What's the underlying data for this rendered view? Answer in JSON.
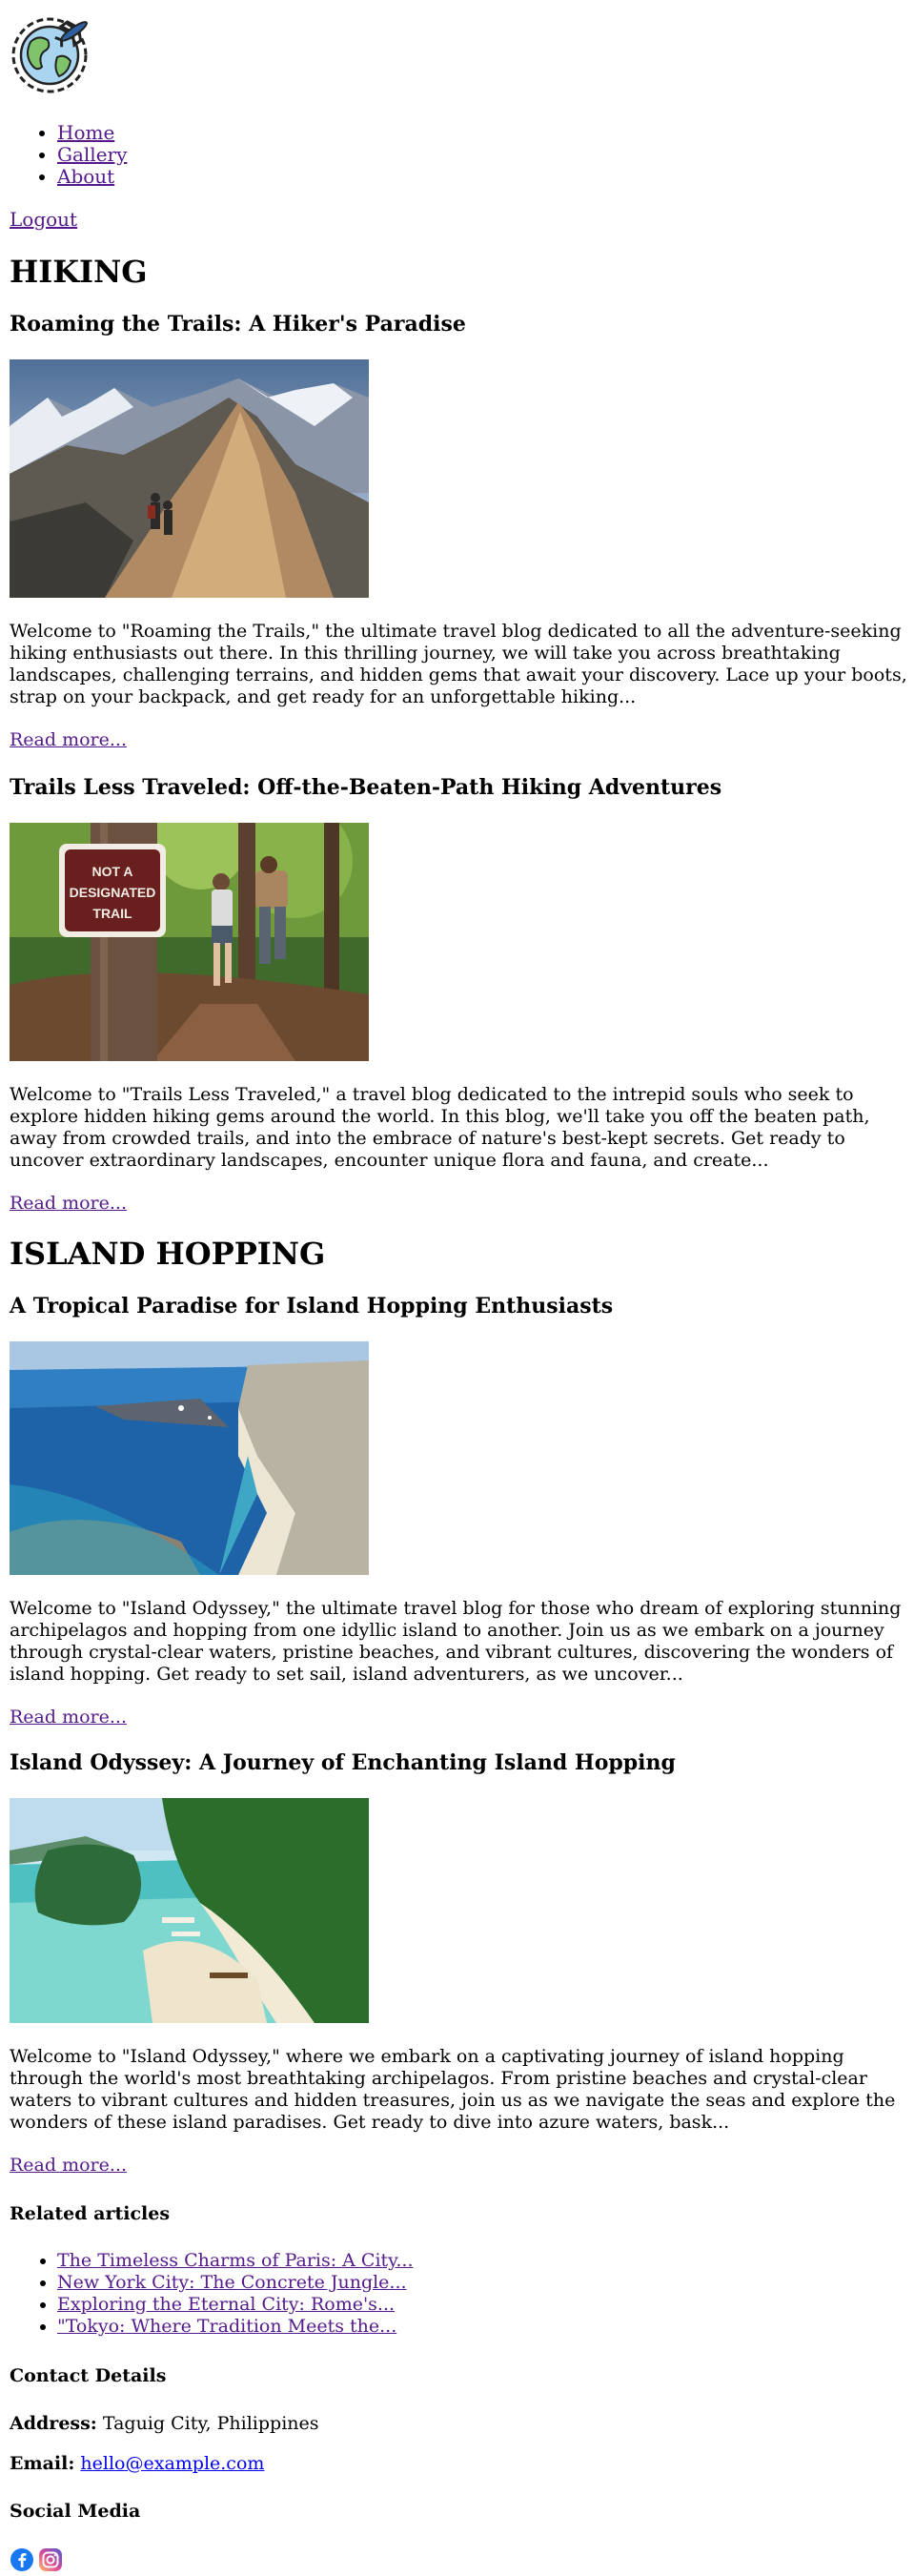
{
  "nav": {
    "items": [
      {
        "label": "Home"
      },
      {
        "label": "Gallery"
      },
      {
        "label": "About"
      }
    ],
    "logout_label": "Logout"
  },
  "sections": [
    {
      "title": "HIKING",
      "posts": [
        {
          "title": "Roaming the Trails: A Hiker's Paradise",
          "excerpt": "Welcome to \"Roaming the Trails,\" the ultimate travel blog dedicated to all the adventure-seeking hiking enthusiasts out there. In this thrilling journey, we will take you across breathtaking landscapes, challenging terrains, and hidden gems that await your discovery. Lace up your boots, strap on your backpack, and get ready for an unforgettable hiking...",
          "read_more": "Read more..."
        },
        {
          "title": "Trails Less Traveled: Off-the-Beaten-Path Hiking Adventures",
          "excerpt": "Welcome to \"Trails Less Traveled,\" a travel blog dedicated to the intrepid souls who seek to explore hidden hiking gems around the world. In this blog, we'll take you off the beaten path, away from crowded trails, and into the embrace of nature's best-kept secrets. Get ready to uncover extraordinary landscapes, encounter unique flora and fauna, and create...",
          "read_more": "Read more...",
          "sign_text": [
            "NOT A",
            "DESIGNATED",
            "TRAIL"
          ]
        }
      ]
    },
    {
      "title": "ISLAND HOPPING",
      "posts": [
        {
          "title": "A Tropical Paradise for Island Hopping Enthusiasts",
          "excerpt": "Welcome to \"Island Odyssey,\" the ultimate travel blog for those who dream of exploring stunning archipelagos and hopping from one idyllic island to another. Join us as we embark on a journey through crystal-clear waters, pristine beaches, and vibrant cultures, discovering the wonders of island hopping. Get ready to set sail, island adventurers, as we uncover...",
          "read_more": "Read more..."
        },
        {
          "title": "Island Odyssey: A Journey of Enchanting Island Hopping",
          "excerpt": "Welcome to \"Island Odyssey,\" where we embark on a captivating journey of island hopping through the world's most breathtaking archipelagos. From pristine beaches and crystal-clear waters to vibrant cultures and hidden treasures, join us as we navigate the seas and explore the wonders of these island paradises. Get ready to dive into azure waters, bask...",
          "read_more": "Read more..."
        }
      ]
    }
  ],
  "related": {
    "title": "Related articles",
    "items": [
      "The Timeless Charms of Paris: A City...",
      "New York City: The Concrete Jungle...",
      "Exploring the Eternal City: Rome's...",
      "\"Tokyo: Where Tradition Meets the..."
    ]
  },
  "contact": {
    "title": "Contact Details",
    "address_label": "Address:",
    "address_value": "Taguig City, Philippines",
    "email_label": "Email:",
    "email_value": "hello@example.com"
  },
  "social": {
    "title": "Social Media",
    "icons": [
      "facebook-icon",
      "instagram-icon"
    ],
    "colors": {
      "facebook": "#1877f2",
      "instagram": "#d6249f"
    }
  }
}
